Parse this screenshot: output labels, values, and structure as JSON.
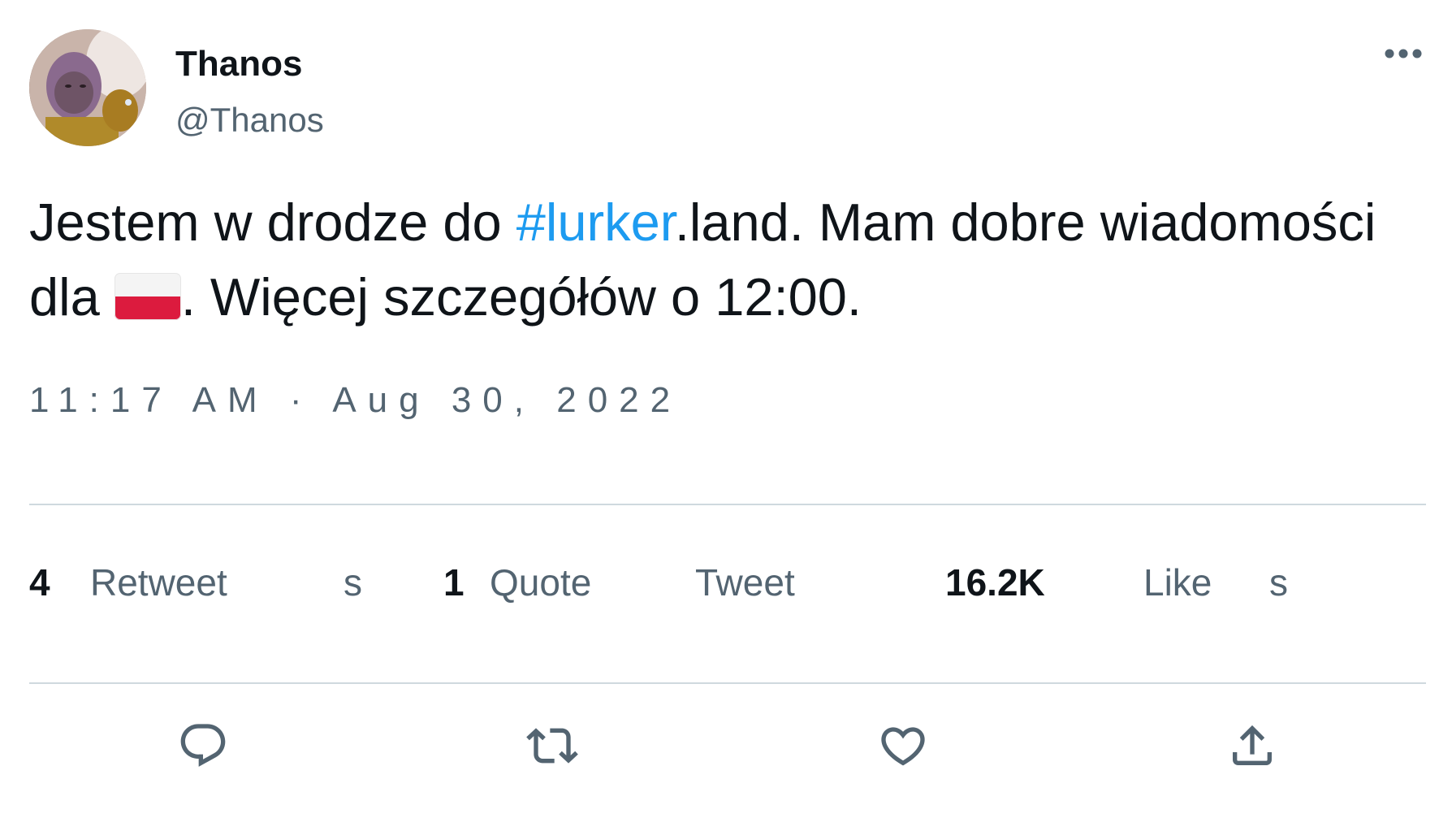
{
  "author": {
    "display_name": "Thanos",
    "handle": "@Thanos"
  },
  "tweet": {
    "text_part1": "Jestem w drodze do ",
    "hashtag": "#lurker",
    "text_part2": ".land. Mam dobre wiadomości dla ",
    "flag_icon": "poland-flag-icon",
    "text_part3": ". Więcej szczegółów o 12:00."
  },
  "timestamp": "11:17 AM · Aug 30, 2022",
  "stats": {
    "retweets_count": "4",
    "retweets_label": "Retweet",
    "retweets_suffix": "s",
    "quotes_count": "1",
    "quotes_label": "Quote",
    "quotes_label2": "Tweet",
    "likes_count": "16.2K",
    "likes_label": "Like",
    "likes_suffix": "s"
  },
  "actions": {
    "reply_icon": "reply-icon",
    "retweet_icon": "retweet-icon",
    "like_icon": "heart-icon",
    "share_icon": "share-icon"
  },
  "colors": {
    "hashtag": "#1d9bf0",
    "secondary_text": "#536471",
    "divider": "#cfd9de",
    "icon": "#536471"
  }
}
